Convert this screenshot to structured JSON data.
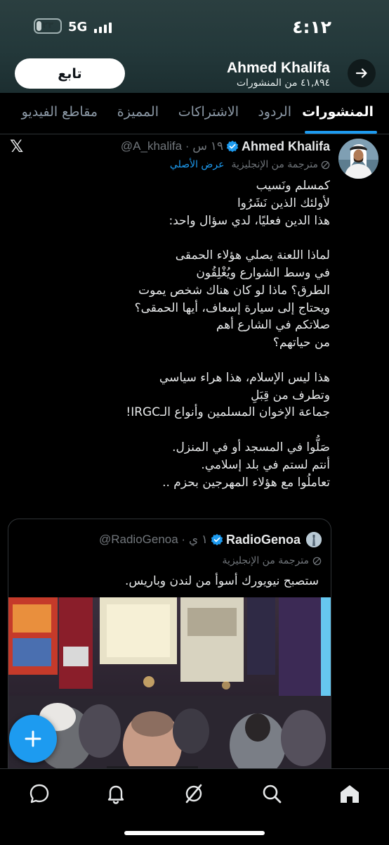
{
  "status_bar": {
    "time": "٤:١٢",
    "network": "5G",
    "battery": "٢٣",
    "battery_level": 0.23
  },
  "header": {
    "name": "Ahmed Khalifa",
    "posts_count": "٤١,٨٩٤ من المنشورات",
    "follow_label": "تابع"
  },
  "tabs": [
    {
      "label": "المنشورات",
      "active": true
    },
    {
      "label": "الردود",
      "active": false
    },
    {
      "label": "الاشتراكات",
      "active": false
    },
    {
      "label": "المميزة",
      "active": false
    },
    {
      "label": "مقاطع الفيديو",
      "active": false
    }
  ],
  "tweet": {
    "author_name": "Ahmed Khalifa",
    "handle_time": "@A_khalifa · ١٩ س",
    "translated_label": "مترجمة من الإنجليزية",
    "show_original": "عرض الأصلي",
    "body_lines": [
      "كمسلم ونَسيب",
      "لأولئك الذين نَشَرُوا",
      "هذا الدين فعليًا، لدي سؤال واحد:",
      "",
      "لماذا اللعنة يصلي هؤلاء الحمقى",
      "في وسط الشوارع ويُغْلِقُون",
      "الطرق؟ ماذا لو كان هناك شخص يموت",
      "ويحتاج إلى سيارة إسعاف، أيها الحمقى؟",
      "صلاتكم في الشارع أهم",
      "من حياتهم؟",
      "",
      "هذا ليس الإسلام، هذا هراء سياسي",
      "وتطرف من قِبَلِ",
      "جماعة الإخوان المسلمين وأنواع الـIRGC!",
      "",
      "صَلُّوا في المسجد أو في المنزل.",
      "أنتم لستم في بلد إسلامي.",
      "تعاملُوا مع هؤلاء المهرجين بحزم .."
    ],
    "quote": {
      "name": "RadioGenoa",
      "handle_time": "@RadioGenoa · ١ ي",
      "translated_label": "مترجمة من الإنجليزية",
      "text": "ستصبح نيويورك أسوأ من لندن وباريس."
    }
  },
  "colors": {
    "accent": "#1d9bf0",
    "background": "#000000",
    "header": "#243838"
  },
  "icons": {
    "fab": "plus-icon",
    "nav": [
      "messages-icon",
      "notifications-icon",
      "grok-icon",
      "search-icon",
      "home-icon"
    ]
  }
}
